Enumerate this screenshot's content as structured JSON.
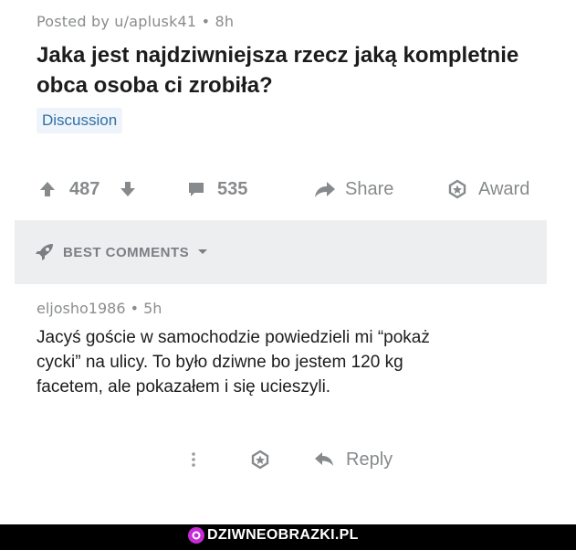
{
  "post": {
    "meta": "Posted by u/aplusk41 • 8h",
    "title": "Jaka jest najdziwniejsza rzecz jaką kompletnie obca osoba ci zrobiła?",
    "flair": "Discussion",
    "score": "487",
    "comments_count": "535",
    "share_label": "Share",
    "award_label": "Award"
  },
  "best_comments": {
    "label": "BEST COMMENTS"
  },
  "comment": {
    "meta": "eljosho1986 • 5h",
    "body": "Jacyś goście w samochodzie powiedzieli mi “pokaż cycki” na ulicy. To było dziwne bo jestem 120 kg facetem, ale pokazałem i się ucieszyli.",
    "reply_label": "Reply"
  },
  "watermark": {
    "text": "DZIWNEOBRAZKI.PL"
  },
  "colors": {
    "accent": "#c52ad6",
    "meta": "#878a8c",
    "text": "#1c1c1c",
    "flair_bg": "#eef4f9",
    "flair_text": "#2f6fa8"
  }
}
